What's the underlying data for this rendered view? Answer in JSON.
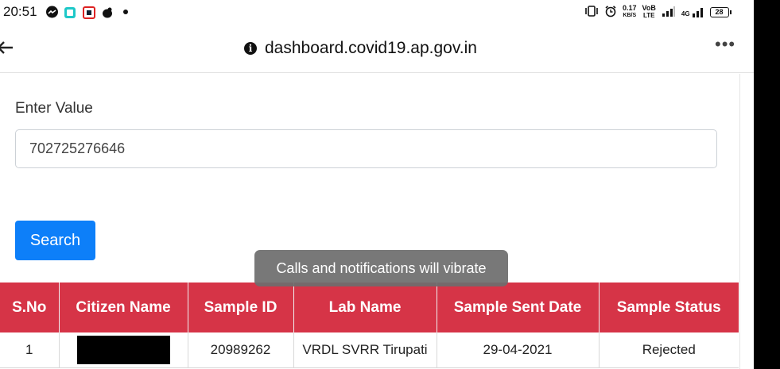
{
  "status_bar": {
    "time": "20:51",
    "left_icons": [
      "messenger-icon",
      "app-icon",
      "notification-icon",
      "bug-icon"
    ],
    "speed_value": "0.17",
    "speed_unit": "KB/S",
    "volte_top": "VoB",
    "volte_bottom": "LTE",
    "network": "4G",
    "battery": "28"
  },
  "browser": {
    "url": "dashboard.covid19.ap.gov.in",
    "menu_glyph": "•••"
  },
  "form": {
    "label": "Enter Value",
    "input_value": "702725276646",
    "search_label": "Search"
  },
  "table": {
    "headers": {
      "sno": "S.No",
      "citizen_name": "Citizen Name",
      "sample_id": "Sample ID",
      "lab_name": "Lab Name",
      "sent_date": "Sample Sent Date",
      "status": "Sample Status"
    },
    "rows": [
      {
        "sno": "1",
        "citizen_name": "",
        "sample_id": "20989262",
        "lab_name": "VRDL SVRR Tirupati",
        "sent_date": "29-04-2021",
        "status": "Rejected"
      }
    ]
  },
  "toast": {
    "message": "Calls and notifications will vibrate"
  },
  "colors": {
    "header_red": "#d63447",
    "button_blue": "#0d7ff9",
    "toast_gray": "#6e6e6e"
  }
}
